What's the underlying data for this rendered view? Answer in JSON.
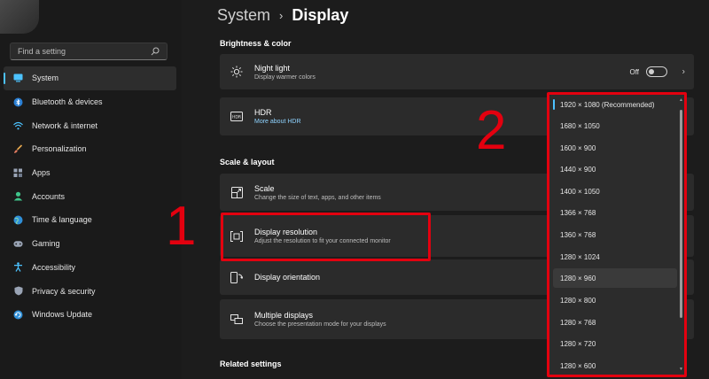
{
  "search": {
    "placeholder": "Find a setting"
  },
  "sidebar": {
    "items": [
      {
        "label": "System",
        "icon": "monitor-icon",
        "active": true
      },
      {
        "label": "Bluetooth & devices",
        "icon": "bluetooth-icon"
      },
      {
        "label": "Network & internet",
        "icon": "wifi-icon"
      },
      {
        "label": "Personalization",
        "icon": "brush-icon"
      },
      {
        "label": "Apps",
        "icon": "apps-icon"
      },
      {
        "label": "Accounts",
        "icon": "person-icon"
      },
      {
        "label": "Time & language",
        "icon": "globe-icon"
      },
      {
        "label": "Gaming",
        "icon": "gamepad-icon"
      },
      {
        "label": "Accessibility",
        "icon": "accessibility-icon"
      },
      {
        "label": "Privacy & security",
        "icon": "shield-icon"
      },
      {
        "label": "Windows Update",
        "icon": "update-icon"
      }
    ]
  },
  "header": {
    "parent": "System",
    "separator": "›",
    "current": "Display"
  },
  "sections": {
    "brightness": "Brightness & color",
    "scale": "Scale & layout",
    "related": "Related settings"
  },
  "cards": {
    "night_light": {
      "title": "Night light",
      "subtitle": "Display warmer colors",
      "toggle_label": "Off",
      "chevron": "›"
    },
    "hdr": {
      "title": "HDR",
      "link": "More about HDR"
    },
    "scale": {
      "title": "Scale",
      "subtitle": "Change the size of text, apps, and other items"
    },
    "resolution": {
      "title": "Display resolution",
      "subtitle": "Adjust the resolution to fit your connected monitor"
    },
    "orientation": {
      "title": "Display orientation"
    },
    "multiple": {
      "title": "Multiple displays",
      "subtitle": "Choose the presentation mode for your displays"
    }
  },
  "annotations": {
    "one": "1",
    "two": "2"
  },
  "dropdown": {
    "options": [
      "1920 × 1080 (Recommended)",
      "1680 × 1050",
      "1600 × 900",
      "1440 × 900",
      "1400 × 1050",
      "1366 × 768",
      "1360 × 768",
      "1280 × 1024",
      "1280 × 960",
      "1280 × 800",
      "1280 × 768",
      "1280 × 720",
      "1280 × 600"
    ],
    "selected_index": 0,
    "hover_index": 8
  },
  "colors": {
    "accent": "#4cc2ff",
    "annotation": "#e3000f"
  }
}
